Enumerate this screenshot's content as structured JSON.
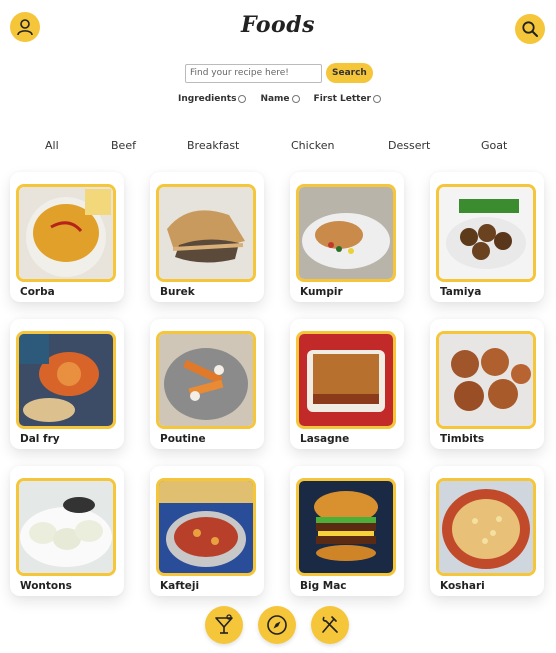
{
  "header": {
    "title": "Foods",
    "profile_icon": "user-icon",
    "search_icon": "search-icon"
  },
  "search": {
    "placeholder": "Find your recipe here!",
    "value": "",
    "button_label": "Search"
  },
  "filters": [
    {
      "label": "Ingredients",
      "checked": false
    },
    {
      "label": "Name",
      "checked": false
    },
    {
      "label": "First Letter",
      "checked": false
    }
  ],
  "categories": [
    "All",
    "Beef",
    "Breakfast",
    "Chicken",
    "Dessert",
    "Goat"
  ],
  "meals": [
    {
      "name": "Corba"
    },
    {
      "name": "Burek"
    },
    {
      "name": "Kumpir"
    },
    {
      "name": "Tamiya"
    },
    {
      "name": "Dal fry"
    },
    {
      "name": "Poutine"
    },
    {
      "name": "Lasagne"
    },
    {
      "name": "Timbits"
    },
    {
      "name": "Wontons"
    },
    {
      "name": "Kafteji"
    },
    {
      "name": "Big Mac"
    },
    {
      "name": "Koshari"
    }
  ],
  "bottom_nav": [
    {
      "icon": "cocktail-icon"
    },
    {
      "icon": "compass-icon"
    },
    {
      "icon": "fork-knife-icon"
    }
  ],
  "colors": {
    "accent": "#f5c53a",
    "text": "#222222"
  }
}
